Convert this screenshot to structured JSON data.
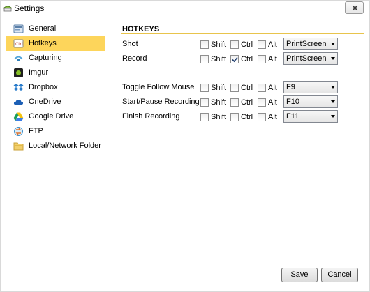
{
  "window": {
    "title": "Settings",
    "icon": "settings-app-icon",
    "close_icon": "close-icon"
  },
  "sidebar": {
    "items": [
      {
        "label": "General",
        "icon": "general-icon"
      },
      {
        "label": "Hotkeys",
        "icon": "keyboard-icon",
        "selected": true
      },
      {
        "label": "Capturing",
        "icon": "capture-icon"
      },
      {
        "label": "Imgur",
        "icon": "imgur-icon"
      },
      {
        "label": "Dropbox",
        "icon": "dropbox-icon"
      },
      {
        "label": "OneDrive",
        "icon": "onedrive-icon"
      },
      {
        "label": "Google Drive",
        "icon": "google-drive-icon"
      },
      {
        "label": "FTP",
        "icon": "ftp-icon"
      },
      {
        "label": "Local/Network Folder",
        "icon": "folder-icon"
      }
    ]
  },
  "hotkeys": {
    "section_title": "HOTKEYS",
    "modifier_labels": {
      "shift": "Shift",
      "ctrl": "Ctrl",
      "alt": "Alt"
    },
    "rows": [
      {
        "label": "Shot",
        "shift": false,
        "ctrl": false,
        "alt": false,
        "key": "PrintScreen"
      },
      {
        "label": "Record",
        "shift": false,
        "ctrl": true,
        "alt": false,
        "key": "PrintScreen"
      },
      {
        "label": "Toggle Follow Mouse",
        "shift": false,
        "ctrl": false,
        "alt": false,
        "key": "F9"
      },
      {
        "label": "Start/Pause Recording",
        "shift": false,
        "ctrl": false,
        "alt": false,
        "key": "F10"
      },
      {
        "label": "Finish Recording",
        "shift": false,
        "ctrl": false,
        "alt": false,
        "key": "F11"
      }
    ]
  },
  "footer": {
    "save_label": "Save",
    "cancel_label": "Cancel"
  },
  "colors": {
    "accent": "#fdd55b",
    "separator": "#e8c44c"
  }
}
